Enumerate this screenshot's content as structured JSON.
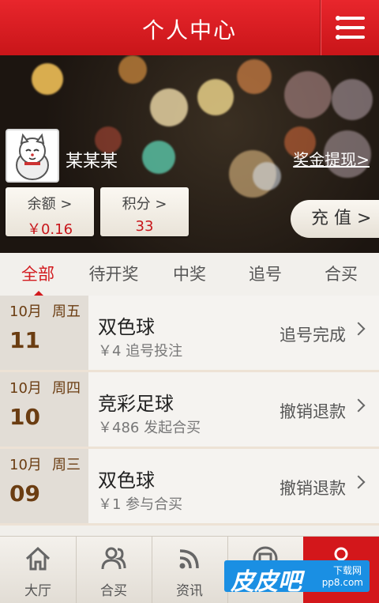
{
  "header": {
    "title": "个人中心",
    "menu_icon": "menu-icon"
  },
  "profile": {
    "username": "某某某",
    "withdraw_link": "奖金提现>",
    "balance": {
      "label": "余额 >",
      "value": "￥0.16"
    },
    "points": {
      "label": "积分 >",
      "value": "33"
    },
    "recharge_label": "充 值 >"
  },
  "tabs": [
    "全部",
    "待开奖",
    "中奖",
    "追号",
    "合买"
  ],
  "active_tab": "全部",
  "records": [
    {
      "month": "10月",
      "weekday": "周五",
      "day": "11",
      "name": "双色球",
      "desc": "￥4 追号投注",
      "status": "追号完成"
    },
    {
      "month": "10月",
      "weekday": "周四",
      "day": "10",
      "name": "竞彩足球",
      "desc": "￥486 发起合买",
      "status": "撤销退款"
    },
    {
      "month": "10月",
      "weekday": "周三",
      "day": "09",
      "name": "双色球",
      "desc": "￥1 参与合买",
      "status": "撤销退款"
    }
  ],
  "bottom_nav": [
    {
      "label": "大厅",
      "icon": "home-icon"
    },
    {
      "label": "合买",
      "icon": "users-icon"
    },
    {
      "label": "资讯",
      "icon": "rss-icon"
    },
    {
      "label": "",
      "icon": "shop-icon"
    },
    {
      "label": "",
      "icon": "person-icon"
    }
  ],
  "watermark": {
    "text": "皮皮吧",
    "sub1": "下载网",
    "sub2": "pp8.com"
  },
  "colors": {
    "brand_red": "#d3171b",
    "date_brown": "#6b3d12",
    "watermark_blue": "#1a8fe3"
  }
}
